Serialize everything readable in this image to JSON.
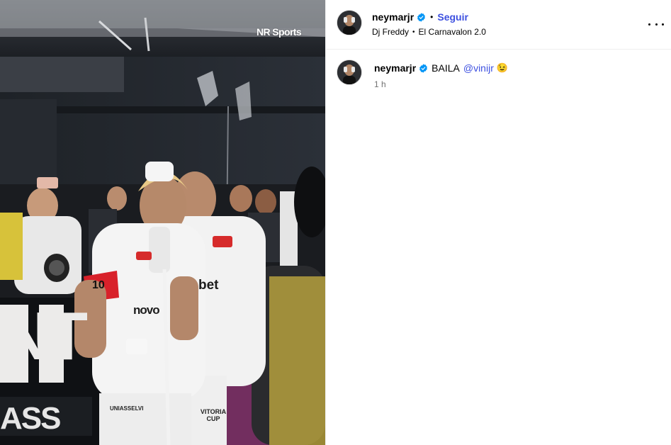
{
  "media": {
    "watermark": "NR Sports",
    "jersey_sponsor": "novo",
    "jersey_sponsor_2": "bet",
    "shorts_text_left": "UNIASSELVI",
    "shorts_text_right": "VITORIA CUP",
    "captain_band_number": "10",
    "ad_board_letters": "NT",
    "ad_board_bottom": "ASS"
  },
  "header": {
    "username": "neymarjr",
    "separator": "•",
    "follow_label": "Seguir",
    "audio_artist": "Dj Freddy",
    "audio_separator": "•",
    "audio_track": "El Carnavalon 2.0"
  },
  "caption": {
    "username": "neymarjr",
    "text": "BAILA",
    "mention": "@vinijr",
    "emoji": "😉",
    "time": "1 h"
  },
  "colors": {
    "link_blue": "#3d50e0",
    "verified_blue": "#0095f6",
    "divider": "#efefef",
    "muted_text": "#737373"
  }
}
